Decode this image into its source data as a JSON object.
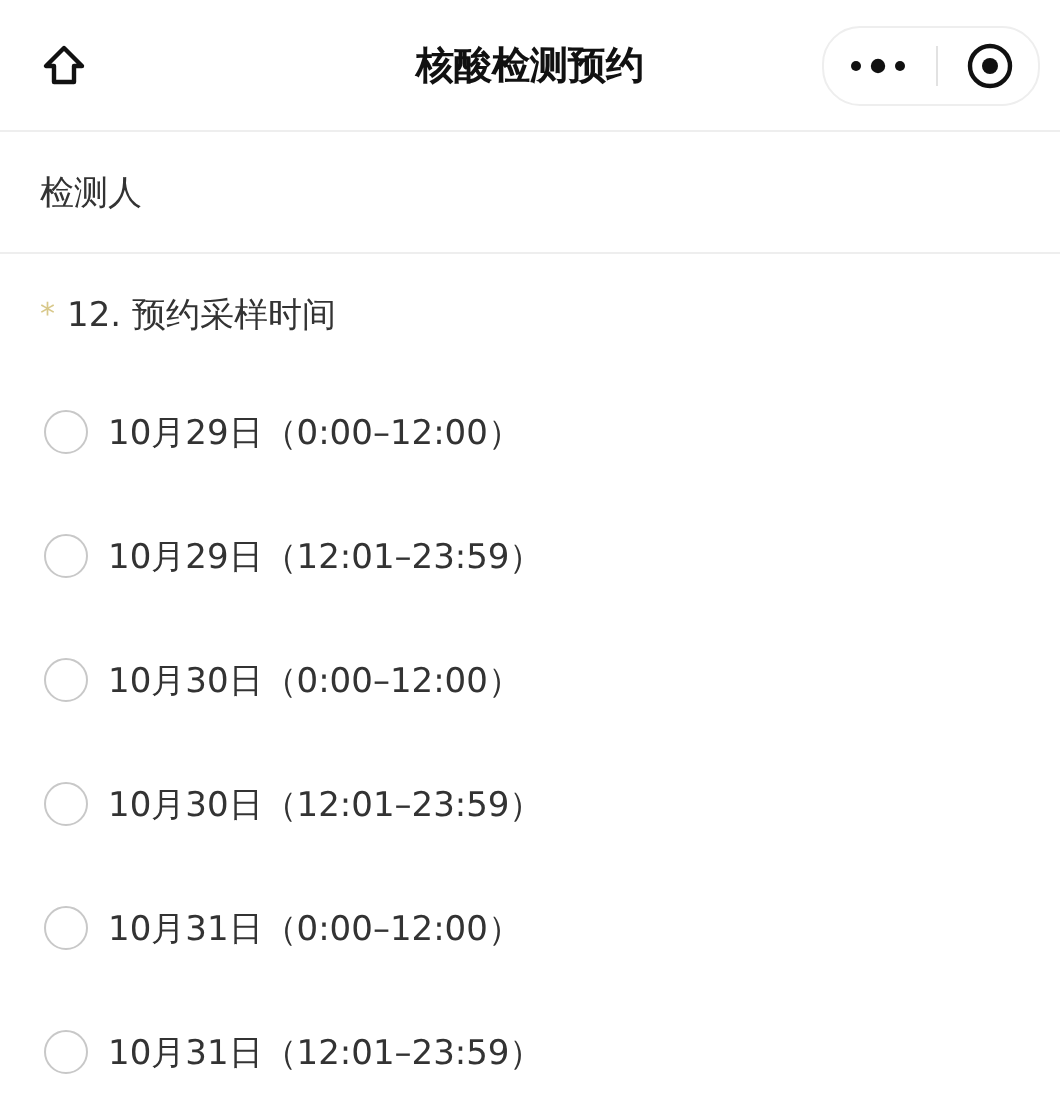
{
  "header": {
    "title": "核酸检测预约"
  },
  "field": {
    "label": "检测人"
  },
  "question": {
    "required_mark": "*",
    "title": "12. 预约采样时间"
  },
  "options": [
    {
      "label": "10月29日（0:00–12:00）",
      "selected": false
    },
    {
      "label": "10月29日（12:01–23:59）",
      "selected": false
    },
    {
      "label": "10月30日（0:00–12:00）",
      "selected": false
    },
    {
      "label": "10月30日（12:01–23:59）",
      "selected": false
    },
    {
      "label": "10月31日（0:00–12:00）",
      "selected": false
    },
    {
      "label": "10月31日（12:01–23:59）",
      "selected": false
    }
  ]
}
